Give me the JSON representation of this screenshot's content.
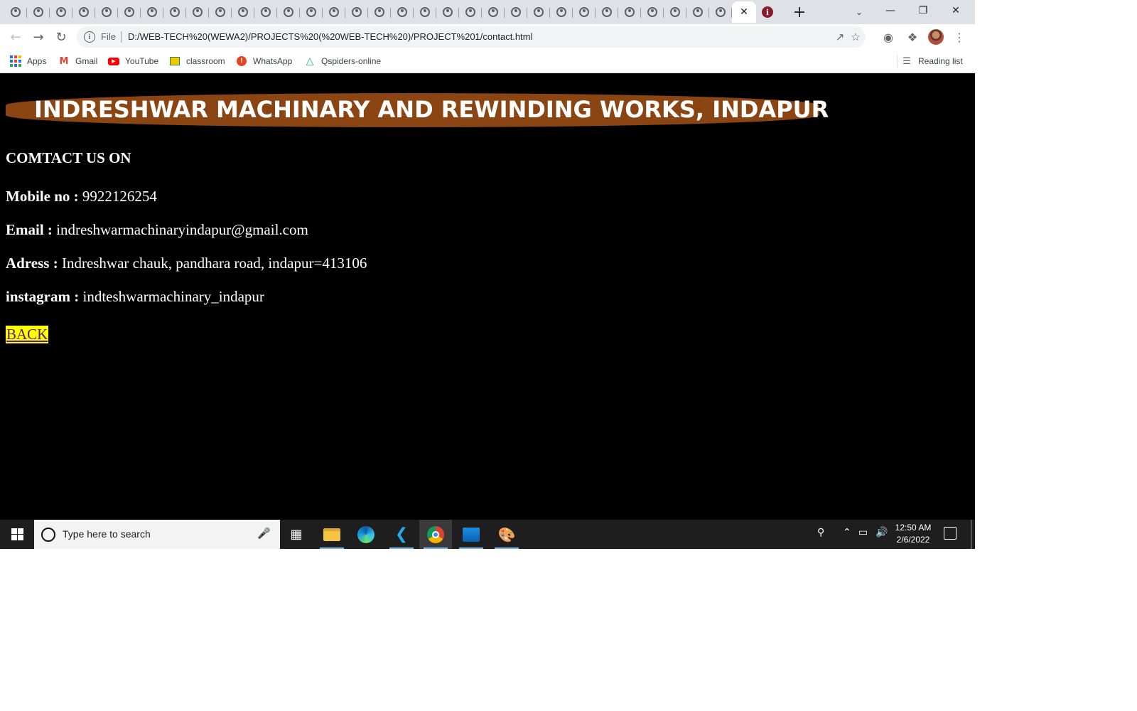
{
  "browser": {
    "tab_count_inactive": 32,
    "url_scheme_chip": "File",
    "url": "D:/WEB-TECH%20(WEWA2)/PROJECTS%20(%20WEB-TECH%20)/PROJECT%201/contact.html",
    "reading_list_label": "Reading list"
  },
  "bookmarks": [
    {
      "label": "Apps",
      "icon": "apps-grid-icon"
    },
    {
      "label": "Gmail",
      "icon": "gmail-icon"
    },
    {
      "label": "YouTube",
      "icon": "youtube-icon"
    },
    {
      "label": "classroom",
      "icon": "classroom-icon"
    },
    {
      "label": "WhatsApp",
      "icon": "whatsapp-icon"
    },
    {
      "label": "Qspiders-online",
      "icon": "qspiders-icon"
    }
  ],
  "page": {
    "banner_title": "INDRESHWAR MACHINARY AND REWINDING WORKS, INDAPUR",
    "contact_heading": "COMTACT US ON",
    "contacts": [
      {
        "label": "Mobile no :",
        "value": "9922126254"
      },
      {
        "label": "Email :",
        "value": "indreshwarmachinaryindapur@gmail.com"
      },
      {
        "label": "Adress :",
        "value": "Indreshwar chauk, pandhara road, indapur=413106"
      },
      {
        "label": "instagram :",
        "value": "indteshwarmachinary_indapur"
      }
    ],
    "back_link": "BACK",
    "colors": {
      "background": "#000000",
      "banner": "#8b4513",
      "back_highlight": "#ffff00"
    }
  },
  "taskbar": {
    "search_placeholder": "Type here to search",
    "time": "12:50 AM",
    "date": "2/6/2022",
    "apps": [
      "task-view",
      "file-explorer",
      "edge",
      "vscode",
      "chrome",
      "photos",
      "paint"
    ]
  }
}
